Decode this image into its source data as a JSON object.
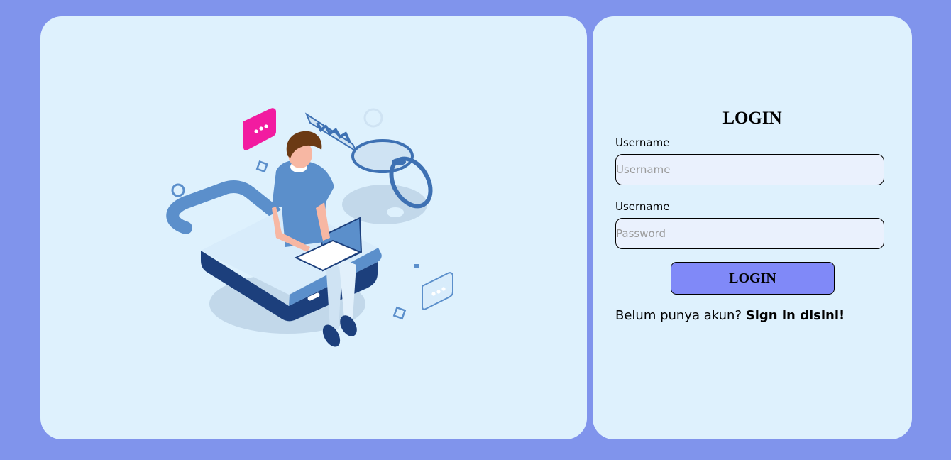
{
  "colors": {
    "page_background": "#8094ec",
    "panel_background": "#def1fd",
    "input_background": "#eaf1fd",
    "button_background": "#8089f8"
  },
  "illustration": {
    "icon": "user-login-key-illustration"
  },
  "login_form": {
    "title": "LOGIN",
    "username_label": "Username",
    "username_placeholder": "Username",
    "username_value": "",
    "password_label": "Username",
    "password_placeholder": "Password",
    "password_value": "",
    "submit_label": "LOGIN",
    "signup_prompt": "Belum punya akun?",
    "signup_link": "Sign in disini!"
  }
}
